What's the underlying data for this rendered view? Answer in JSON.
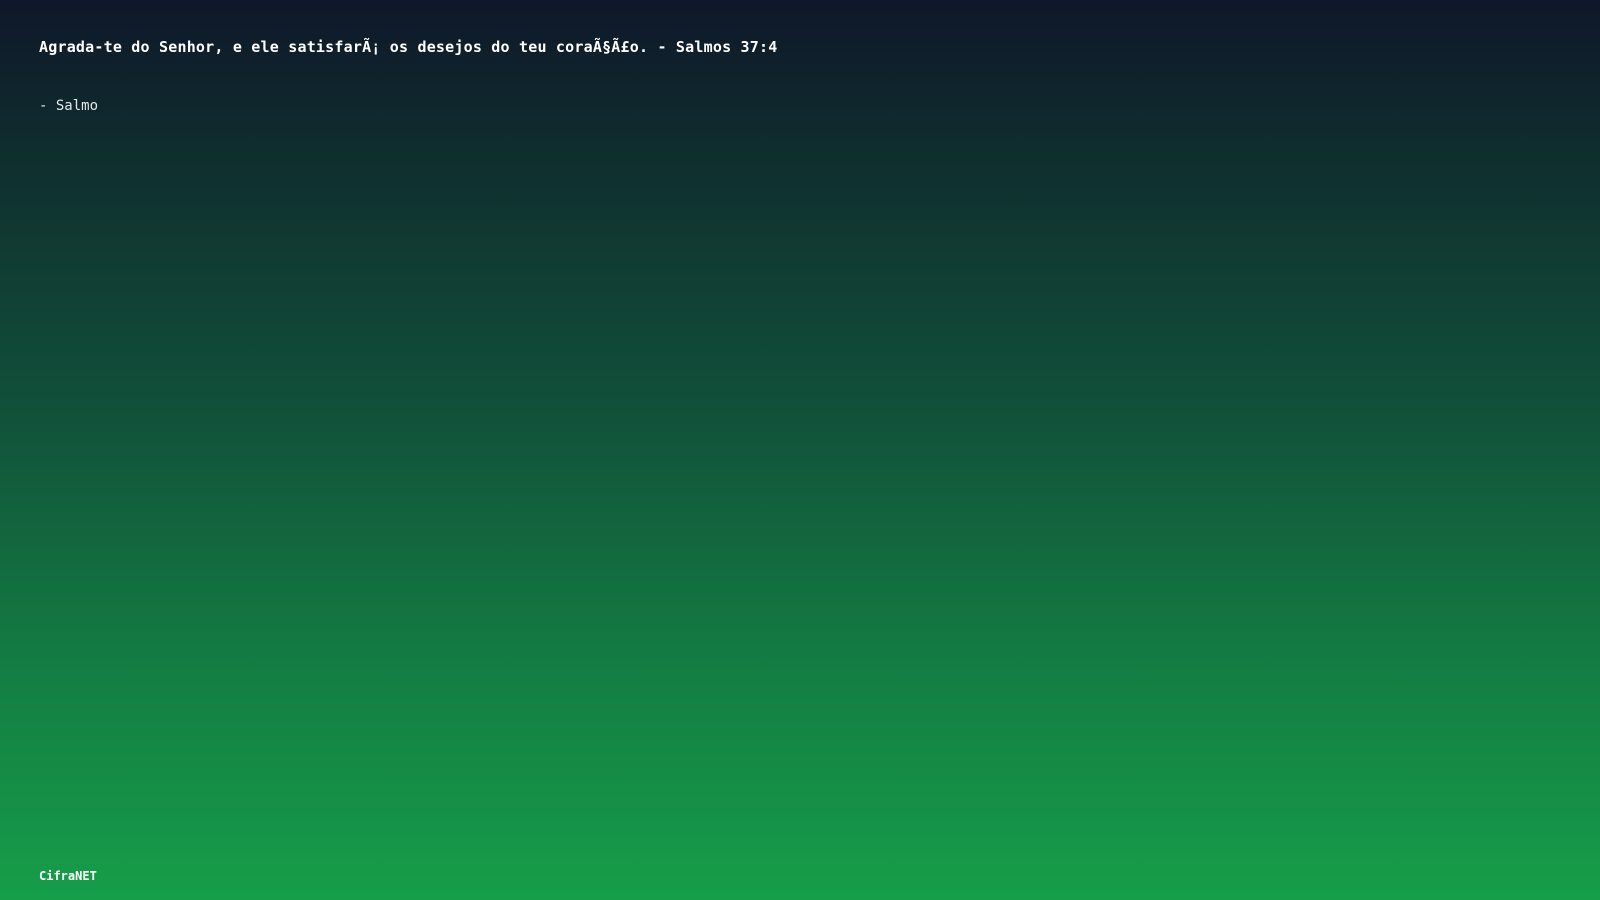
{
  "quote": {
    "text": "Agrada-te do Senhor, e ele satisfarÃ¡ os desejos do teu coraÃ§Ã£o. - Salmos 37:4",
    "author": "- Salmo"
  },
  "footer": {
    "brand": "CifraNET"
  },
  "colors": {
    "gradient_top": "#0f172a",
    "gradient_bottom": "#169e49",
    "text": "#ffffff"
  }
}
